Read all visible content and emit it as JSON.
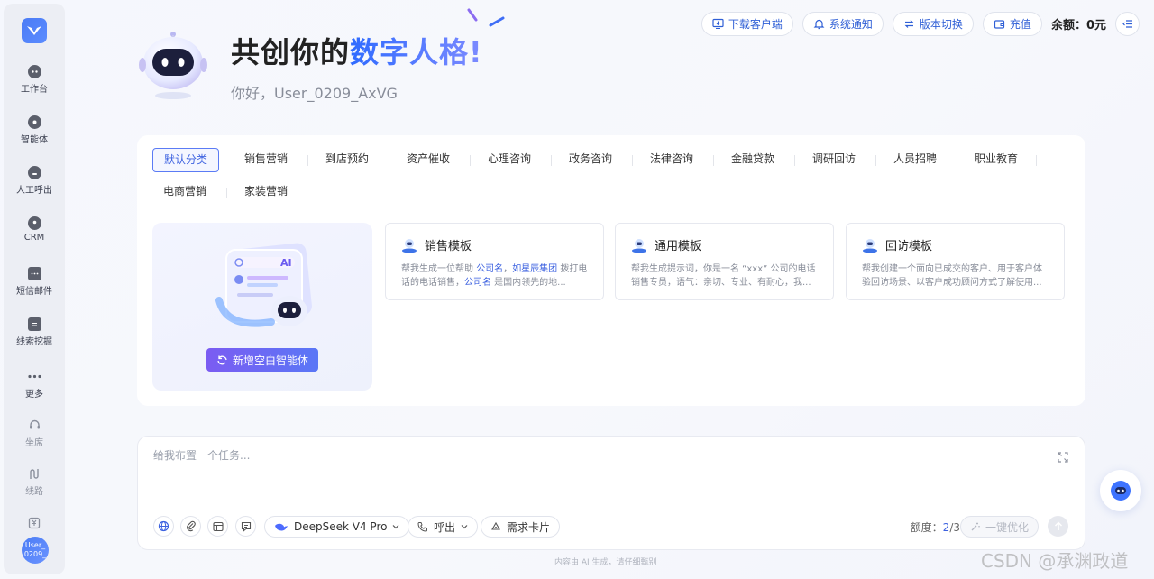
{
  "sidebar": {
    "items": [
      {
        "label": "工作台",
        "icon": "workbench-icon"
      },
      {
        "label": "智能体",
        "icon": "agent-icon"
      },
      {
        "label": "人工呼出",
        "icon": "outbound-call-icon"
      },
      {
        "label": "CRM",
        "icon": "crm-icon"
      },
      {
        "label": "短信邮件",
        "icon": "sms-mail-icon"
      },
      {
        "label": "线索挖掘",
        "icon": "lead-mining-icon"
      },
      {
        "label": "更多",
        "icon": "more-icon"
      },
      {
        "label": "坐席",
        "icon": "headset-icon"
      },
      {
        "label": "线路",
        "icon": "route-icon"
      }
    ],
    "avatar_text": "User_ 0209_"
  },
  "hero": {
    "title_plain": "共创你的",
    "title_accent": "数字人格!",
    "greeting": "你好，User_0209_AxVG"
  },
  "top_actions": {
    "download": "下载客户端",
    "notify": "系统通知",
    "switch_version": "版本切换",
    "recharge": "充值",
    "balance_label": "余额：",
    "balance_value": "0元"
  },
  "tabs": [
    "默认分类",
    "销售营销",
    "到店预约",
    "资产催收",
    "心理咨询",
    "政务咨询",
    "法律咨询",
    "金融贷款",
    "调研回访",
    "人员招聘",
    "职业教育",
    "电商营销",
    "家装营销"
  ],
  "create_card": {
    "button": "新增空白智能体",
    "ai_badge": "AI"
  },
  "templates": [
    {
      "title": "销售模板",
      "desc_pre": "帮我生成一位帮助 ",
      "desc_link1": "公司名",
      "desc_mid": "，",
      "desc_link2": "如星辰集团",
      "desc_post1": " 拨打电话的电话销售，",
      "desc_link3": "公司名",
      "desc_post2": " 是国内领先的地..."
    },
    {
      "title": "通用模板",
      "desc": "帮我生成提示词，你是一名 “xxx” 公司的电话销售专员，语气：亲切、专业、有耐心，我..."
    },
    {
      "title": "回访模板",
      "desc": "帮我创建一个面向已成交的客户、用于客户体验回访场景、以客户成功顾问方式了解使用..."
    }
  ],
  "composer": {
    "placeholder": "给我布置一个任务...",
    "model": "DeepSeek V4 Pro",
    "call": "呼出",
    "demand_card": "需求卡片",
    "quota_label": "额度：",
    "quota_used": "2",
    "quota_total": "/3",
    "optimize": "一键优化"
  },
  "footer_note": "内容由 AI 生成，请仔细甄别",
  "watermark": "CSDN @承渊政道",
  "colors": {
    "accent": "#3d62e0",
    "brand_gradient_start": "#7b5cf2",
    "brand_gradient_end": "#5a77f6"
  }
}
